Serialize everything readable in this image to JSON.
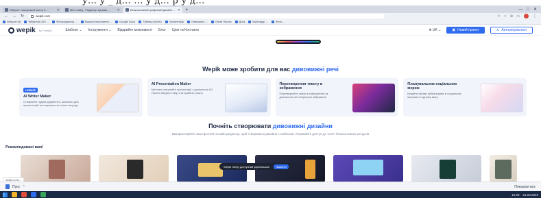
{
  "caption_partial": "у... у _ д... ... у д... р у д...",
  "browser": {
    "tabs": [
      {
        "title": "Wikiport: пошуковий мотор 6 ...",
        "active": false
      },
      {
        "title": "Мій слайд - Редактор від вам ...",
        "active": false
      },
      {
        "title": "Безкоштовний графічний дизайн ...",
        "active": true
      }
    ],
    "new_tab_symbol": "+",
    "window_buttons": [
      "—",
      "□",
      "✕"
    ],
    "address": "wepik.com",
    "bookmarks": [
      "Wikiport (9)",
      "Wikipedia 100 ...",
      "Фоторедактор ...",
      "Корисні посилання ...",
      "Google Docs",
      "Таблиці (excel)",
      "Презентації",
      "Навчальні ...",
      "Gmail Пошта",
      "Диск",
      "Календар ...",
      "Фото ..."
    ]
  },
  "site": {
    "logo": "wepik",
    "logo_sub": "by Freepik",
    "nav": [
      "Шаблон ⌄",
      "Інструменти ⌄",
      "Відкрийте можливості",
      "Блог",
      "Ціни та Контакти"
    ],
    "lang": "⊕ UK ⌄",
    "primary_button": "Новий проект",
    "outline_button": "Авторизуватися"
  },
  "section1": {
    "title_prefix": "Wepik може зробити для вас ",
    "title_accent": "дивовижні речі",
    "features": [
      {
        "badge": "НОВИЙ",
        "title": "AI Writer Maker",
        "desc": "Створюйте чудові документи, шаблони для презентацій та соцмереж за лічені секунди"
      },
      {
        "badge": "",
        "title": "AI Presentation Maker",
        "desc": "Миттєво створюйте презентації з допомогою ШІ. Просто введіть тему, а AI зробить решту"
      },
      {
        "badge": "",
        "title": "Перетворення тексту в зображення",
        "desc": "Перетворюйте описи в зображення за допомогою AI генератора зображень"
      },
      {
        "badge": "",
        "title": "Планувальник соціальних мереж",
        "desc": "Керуйте своїми публікаціями в соціальних мережах в одному місці"
      }
    ]
  },
  "section2": {
    "title_prefix": "Почніть створювати ",
    "title_accent": "дивовижні дизайни",
    "subtitle": "Використовуйте наш простий онлайн-редактор, щоб створювати дизайни з шаблонів. Отримайте доступ до тисяч безкоштовних ресурсів"
  },
  "recommended": {
    "label": "Рекомендовані вам!",
    "promo_text": "Wepik тепер доступний українською",
    "promo_button": "Змінити"
  },
  "downloads": {
    "tooltip": "wepik.com/...",
    "item": "Пуск",
    "show_all": "Показати все"
  },
  "taskbar": {
    "time": "10:28",
    "date": "21.03.2023"
  }
}
